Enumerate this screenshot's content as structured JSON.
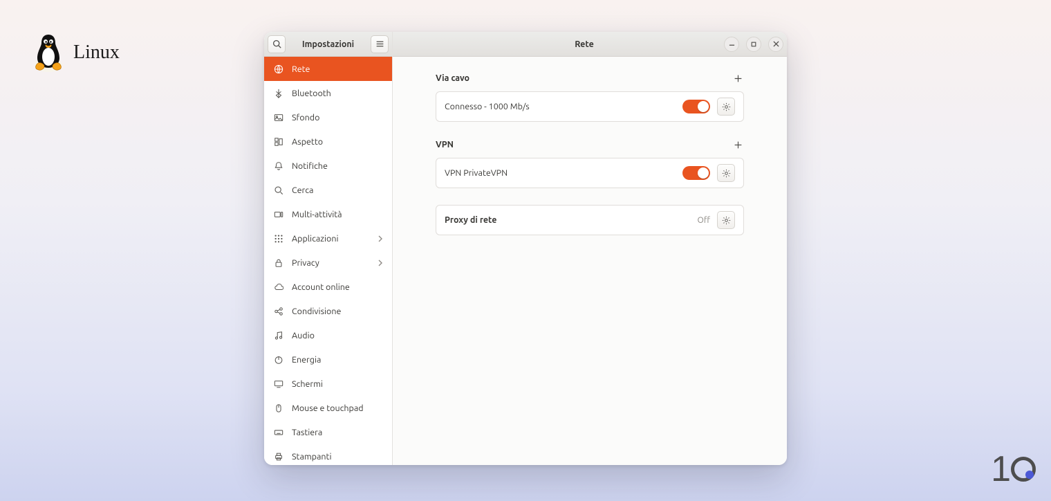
{
  "brand": {
    "wordmark": "Linux"
  },
  "sidebar_title": "Impostazioni",
  "page_title": "Rete",
  "sidebar": {
    "items": [
      {
        "label": "Rete",
        "selected": true,
        "icon": "globe-icon"
      },
      {
        "label": "Bluetooth",
        "icon": "bluetooth-icon"
      },
      {
        "label": "Sfondo",
        "icon": "picture-icon"
      },
      {
        "label": "Aspetto",
        "icon": "appearance-icon"
      },
      {
        "label": "Notifiche",
        "icon": "bell-icon"
      },
      {
        "label": "Cerca",
        "icon": "search-icon"
      },
      {
        "label": "Multi-attività",
        "icon": "workspaces-icon"
      },
      {
        "label": "Applicazioni",
        "icon": "grid-icon",
        "chevron": true
      },
      {
        "label": "Privacy",
        "icon": "lock-icon",
        "chevron": true
      },
      {
        "label": "Account online",
        "icon": "cloud-icon"
      },
      {
        "label": "Condivisione",
        "icon": "share-icon"
      },
      {
        "label": "Audio",
        "icon": "music-icon"
      },
      {
        "label": "Energia",
        "icon": "power-icon"
      },
      {
        "label": "Schermi",
        "icon": "display-icon"
      },
      {
        "label": "Mouse e touchpad",
        "icon": "mouse-icon"
      },
      {
        "label": "Tastiera",
        "icon": "keyboard-icon"
      },
      {
        "label": "Stampanti",
        "icon": "printer-icon"
      }
    ]
  },
  "sections": {
    "wired": {
      "title": "Via cavo",
      "status": "Connesso - 1000 Mb/s",
      "toggle_on": true
    },
    "vpn": {
      "title": "VPN",
      "name": "VPN PrivateVPN",
      "toggle_on": true
    },
    "proxy": {
      "title": "Proxy di rete",
      "state": "Off"
    }
  }
}
